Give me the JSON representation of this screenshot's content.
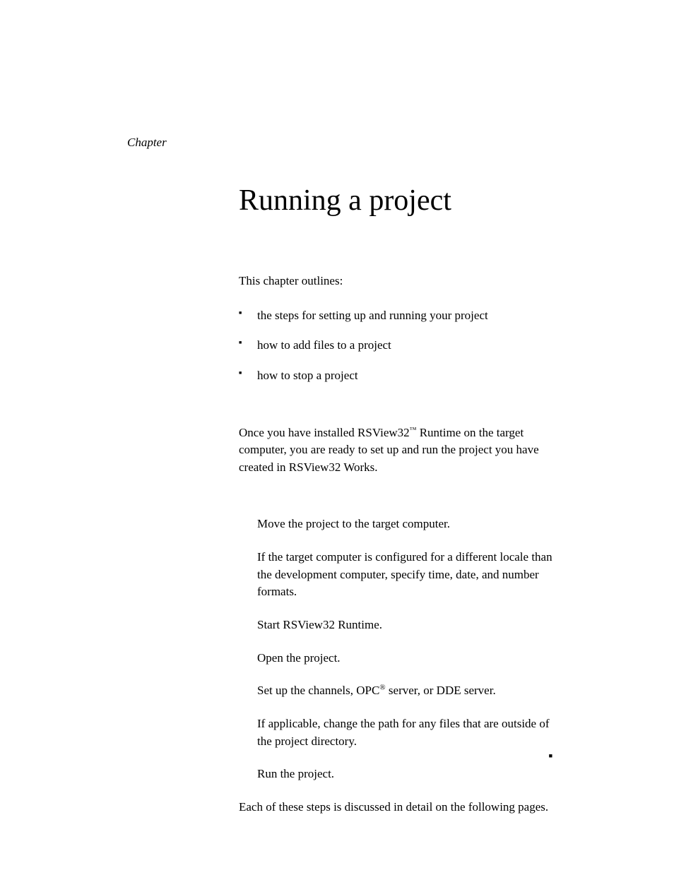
{
  "chapter_label": "Chapter",
  "title": "Running a project",
  "intro": "This chapter outlines:",
  "bullets": [
    "the steps for setting up and running your project",
    "how to add files to a project",
    "how to stop a project"
  ],
  "paragraph_pre": "Once you have installed RSView32",
  "paragraph_tm": "™",
  "paragraph_post": " Runtime on the target computer, you are ready to set up and run the project you have created in RSView32 Works.",
  "steps": {
    "s1": "Move the project to the target computer.",
    "s2": "If the target computer is configured for a different locale than the development computer, specify time, date, and number formats.",
    "s3": "Start RSView32 Runtime.",
    "s4": "Open the project.",
    "s5_pre": "Set up the channels, OPC",
    "s5_reg": "®",
    "s5_post": " server, or DDE server.",
    "s6": "If applicable, change the path for any files that are outside of the project directory.",
    "s7": "Run the project."
  },
  "closing": "Each of these steps is discussed in detail on the following pages.",
  "marker": "■"
}
